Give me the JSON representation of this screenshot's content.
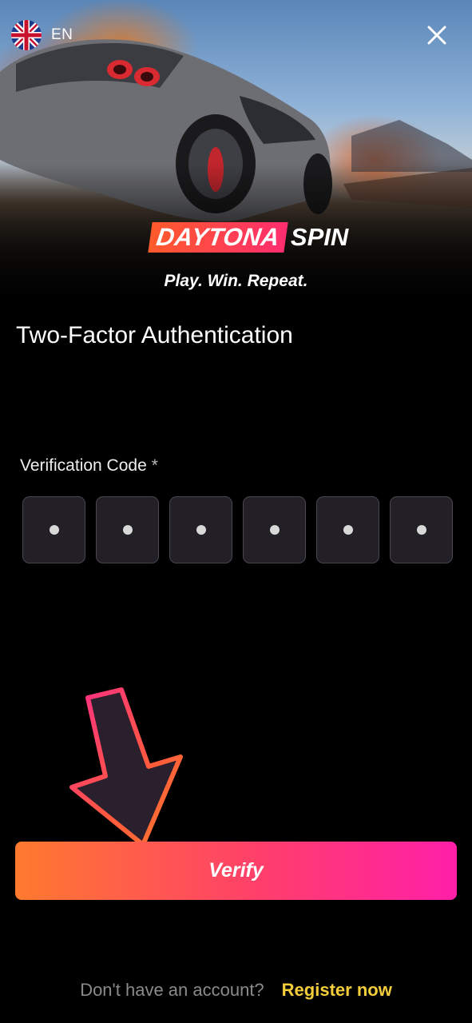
{
  "header": {
    "language": {
      "code": "EN",
      "flag_icon": "uk-flag-icon"
    },
    "close_icon": "close-icon"
  },
  "brand": {
    "logo_left": "DAYTONA",
    "logo_right": "SPIN",
    "tagline": "Play. Win. Repeat."
  },
  "form": {
    "title": "Two-Factor Authentication",
    "code_label": "Verification Code",
    "required_mark": "*",
    "code_digits": [
      "",
      "",
      "",
      "",
      "",
      ""
    ],
    "verify_label": "Verify"
  },
  "footer": {
    "question": "Don't have an account?",
    "register_label": "Register now"
  },
  "colors": {
    "background": "#000000",
    "accent_start": "#ff7a2e",
    "accent_end": "#ff1fa9",
    "link": "#f3cd3a",
    "input_bg": "#221f26"
  }
}
